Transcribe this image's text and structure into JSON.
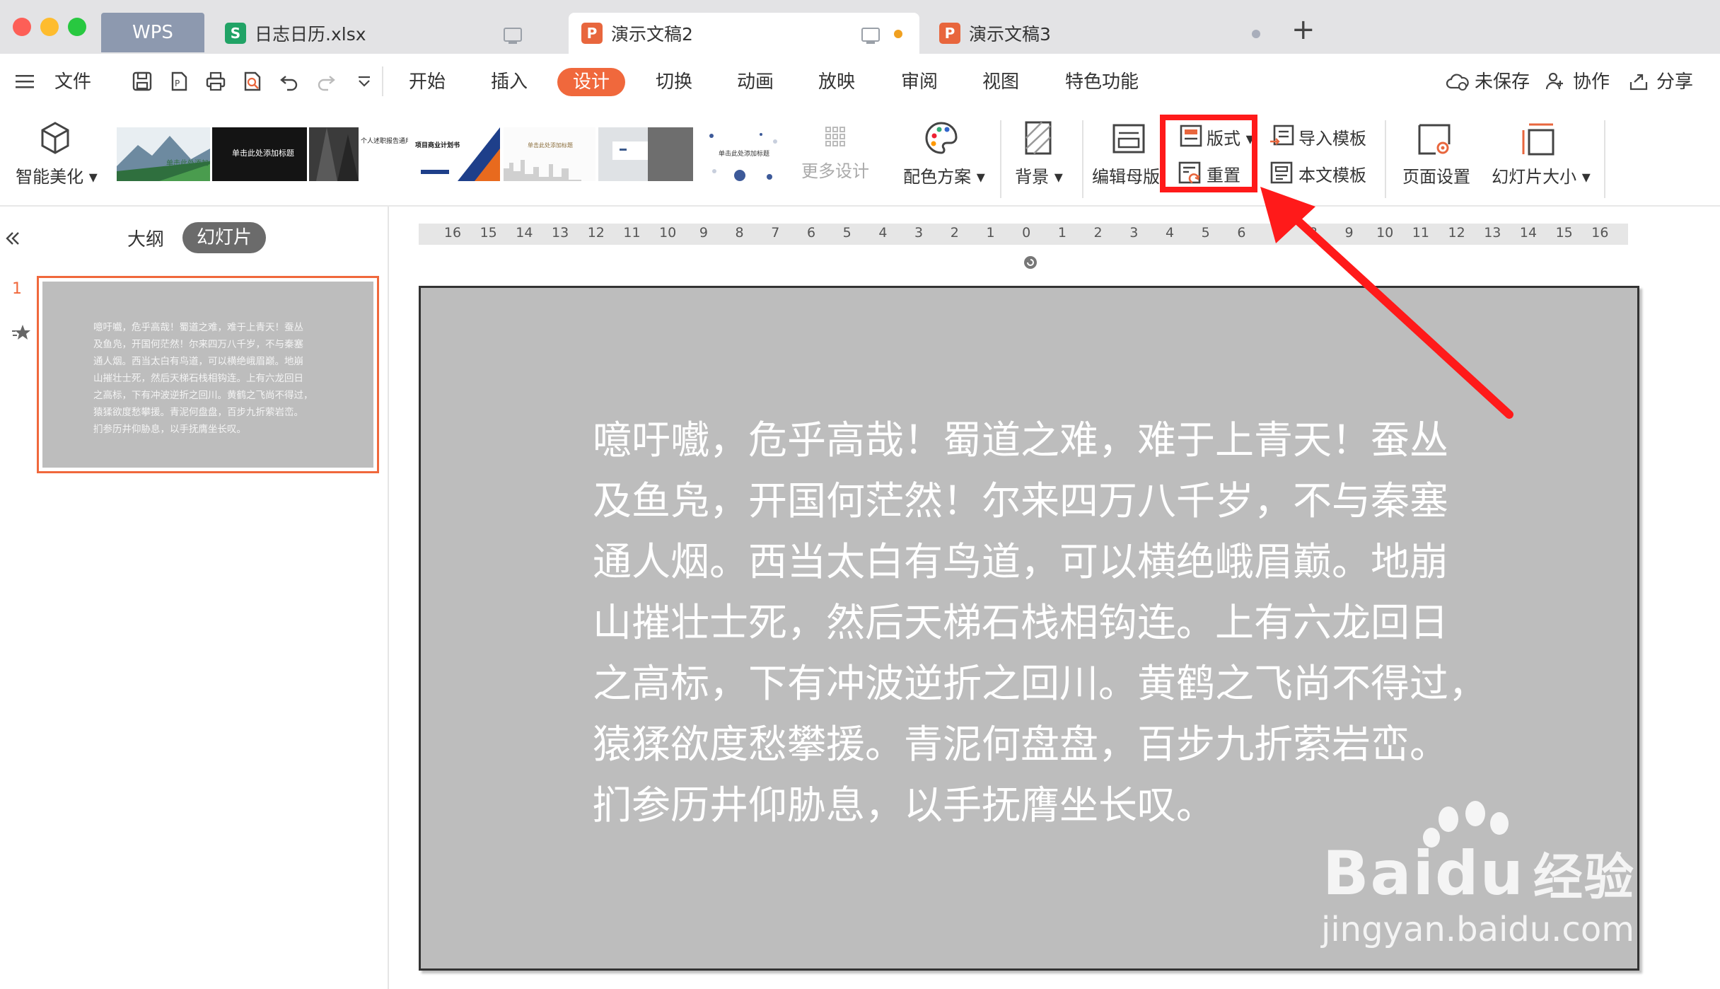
{
  "window": {
    "tabs": [
      {
        "label": "WPS"
      },
      {
        "label": "日志日历.xlsx",
        "icon": "S"
      },
      {
        "label": "演示文稿2",
        "icon": "P"
      },
      {
        "label": "演示文稿3",
        "icon": "P"
      }
    ],
    "new_tab": "+"
  },
  "menu": {
    "file": "文件",
    "items": [
      "开始",
      "插入",
      "设计",
      "切换",
      "动画",
      "放映",
      "审阅",
      "视图",
      "特色功能"
    ],
    "active": "设计",
    "right": {
      "unsaved": "未保存",
      "collab": "协作",
      "share": "分享"
    }
  },
  "ribbon": {
    "beautify": "智能美化",
    "more_design": "更多设计",
    "color_scheme": "配色方案",
    "background": "背景",
    "edit_master": "编辑母版",
    "layout": "版式",
    "reset": "重置",
    "import_template": "导入模板",
    "this_template": "本文模板",
    "page_setup": "页面设置",
    "slide_size": "幻灯片大小",
    "theme_texts": [
      "单击此处添加标题",
      "单击此处添加标题",
      "个人述职报告通用",
      "项目商业计划书",
      "单击此处添加标题",
      "单击此处添加标题"
    ]
  },
  "panel": {
    "outline": "大纲",
    "slides": "幻灯片",
    "slide_number": "1"
  },
  "ruler": [
    "16",
    "15",
    "14",
    "13",
    "12",
    "11",
    "10",
    "9",
    "8",
    "7",
    "6",
    "5",
    "4",
    "3",
    "2",
    "1",
    "0",
    "1",
    "2",
    "3",
    "4",
    "5",
    "6",
    "7",
    "8",
    "9",
    "10",
    "11",
    "12",
    "13",
    "14",
    "15",
    "16"
  ],
  "slide": {
    "lines": [
      "噫吁嚱，危乎高哉！蜀道之难，难于上青天！蚕丛",
      "及鱼凫，开国何茫然！尔来四万八千岁，不与秦塞",
      "通人烟。西当太白有鸟道，可以横绝峨眉巅。地崩",
      "山摧壮士死，然后天梯石栈相钩连。上有六龙回日",
      "之高标，下有冲波逆折之回川。黄鹤之飞尚不得过，",
      "猿猱欲度愁攀援。青泥何盘盘，百步九折萦岩峦。",
      "扪参历井仰胁息，以手抚膺坐长叹。"
    ]
  },
  "watermark": {
    "brand": "Baidu",
    "cn": "经验",
    "url": "jingyan.baidu.com"
  },
  "colors": {
    "accent": "#f0683c",
    "highlight": "#ff1a1a",
    "slide_bg": "#bdbdbd"
  }
}
